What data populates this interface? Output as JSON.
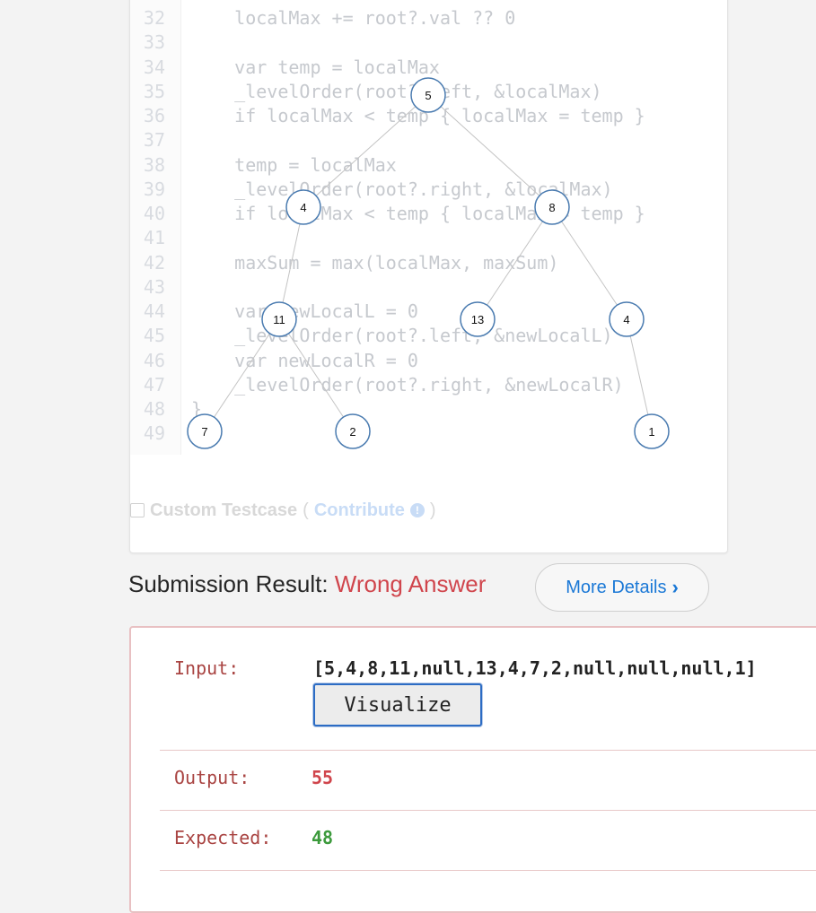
{
  "editor": {
    "line_numbers": [
      "32",
      "33",
      "34",
      "35",
      "36",
      "37",
      "38",
      "39",
      "40",
      "41",
      "42",
      "43",
      "44",
      "45",
      "46",
      "47",
      "48",
      "49"
    ],
    "lines": [
      "    localMax += root?.val ?? 0",
      "",
      "    var temp = localMax",
      "    _levelOrder(root?.left, &localMax)",
      "    if localMax < temp { localMax = temp }",
      "",
      "    temp = localMax",
      "    _levelOrder(root?.right, &localMax)",
      "    if localMax < temp { localMax = temp }",
      "",
      "    maxSum = max(localMax, maxSum)",
      "",
      "    var newLocalL = 0",
      "    _levelOrder(root?.left, &newLocalL)",
      "    var newLocalR = 0",
      "    _levelOrder(root?.right, &newLocalR)",
      "}",
      ""
    ]
  },
  "tree": {
    "nodes": [
      "5",
      "4",
      "8",
      "11",
      "13",
      "4",
      "7",
      "2",
      "1"
    ],
    "edges": [
      [
        0,
        1
      ],
      [
        0,
        2
      ],
      [
        1,
        3
      ],
      [
        2,
        4
      ],
      [
        2,
        5
      ],
      [
        3,
        6
      ],
      [
        3,
        7
      ],
      [
        5,
        8
      ]
    ],
    "colors": {
      "stroke": "#4a7bb0",
      "edge": "#c4c4c4"
    }
  },
  "custom_testcase": {
    "label": "Custom Testcase",
    "open_paren": "(",
    "contribute": "Contribute",
    "close_paren": ")"
  },
  "submission": {
    "prefix": "Submission Result:",
    "status": "Wrong Answer",
    "status_color": "#d0454c",
    "more_details": "More Details"
  },
  "result": {
    "input_label": "Input:",
    "input_value": "[5,4,8,11,null,13,4,7,2,null,null,null,1]",
    "visualize_label": "Visualize",
    "output_label": "Output:",
    "output_value": "55",
    "output_color": "#d0454c",
    "expected_label": "Expected:",
    "expected_value": "48",
    "expected_color": "#3c9a3c"
  }
}
